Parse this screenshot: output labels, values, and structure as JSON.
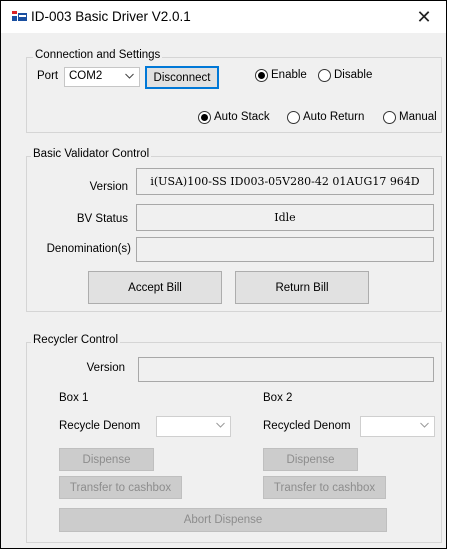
{
  "window": {
    "title": "ID-003 Basic Driver V2.0.1",
    "close_glyph": "✕",
    "app_icon": "app-icon"
  },
  "connection": {
    "group_title": "Connection and Settings",
    "port_label": "Port",
    "port_value": "COM2",
    "disconnect_label": "Disconnect",
    "enable_label": "Enable",
    "enable_selected": true,
    "disable_label": "Disable",
    "auto_stack_label": "Auto Stack",
    "auto_stack_selected": true,
    "auto_return_label": "Auto Return",
    "manual_label": "Manual"
  },
  "validator": {
    "group_title": "Basic Validator Control",
    "version_label": "Version",
    "version_value": "i(USA)100-SS ID003-05V280-42 01AUG17 964D",
    "status_label": "BV Status",
    "status_value": "Idle",
    "denomination_label": "Denomination(s)",
    "denomination_value": "",
    "accept_label": "Accept Bill",
    "return_label": "Return Bill"
  },
  "recycler": {
    "group_title": "Recycler Control",
    "version_label": "Version",
    "version_value": "",
    "box1_label": "Box 1",
    "box2_label": "Box 2",
    "recycle_denom_label": "Recycle Denom",
    "recycled_denom_label": "Recycled Denom",
    "dispense1_label": "Dispense",
    "dispense2_label": "Dispense",
    "transfer1_label": "Transfer to cashbox",
    "transfer2_label": "Transfer to cashbox",
    "abort_label": "Abort Dispense"
  },
  "colors": {
    "focus_border": "#0078d7",
    "disabled_text": "#8d8d8d",
    "window_bg": "#f0f0f0"
  }
}
